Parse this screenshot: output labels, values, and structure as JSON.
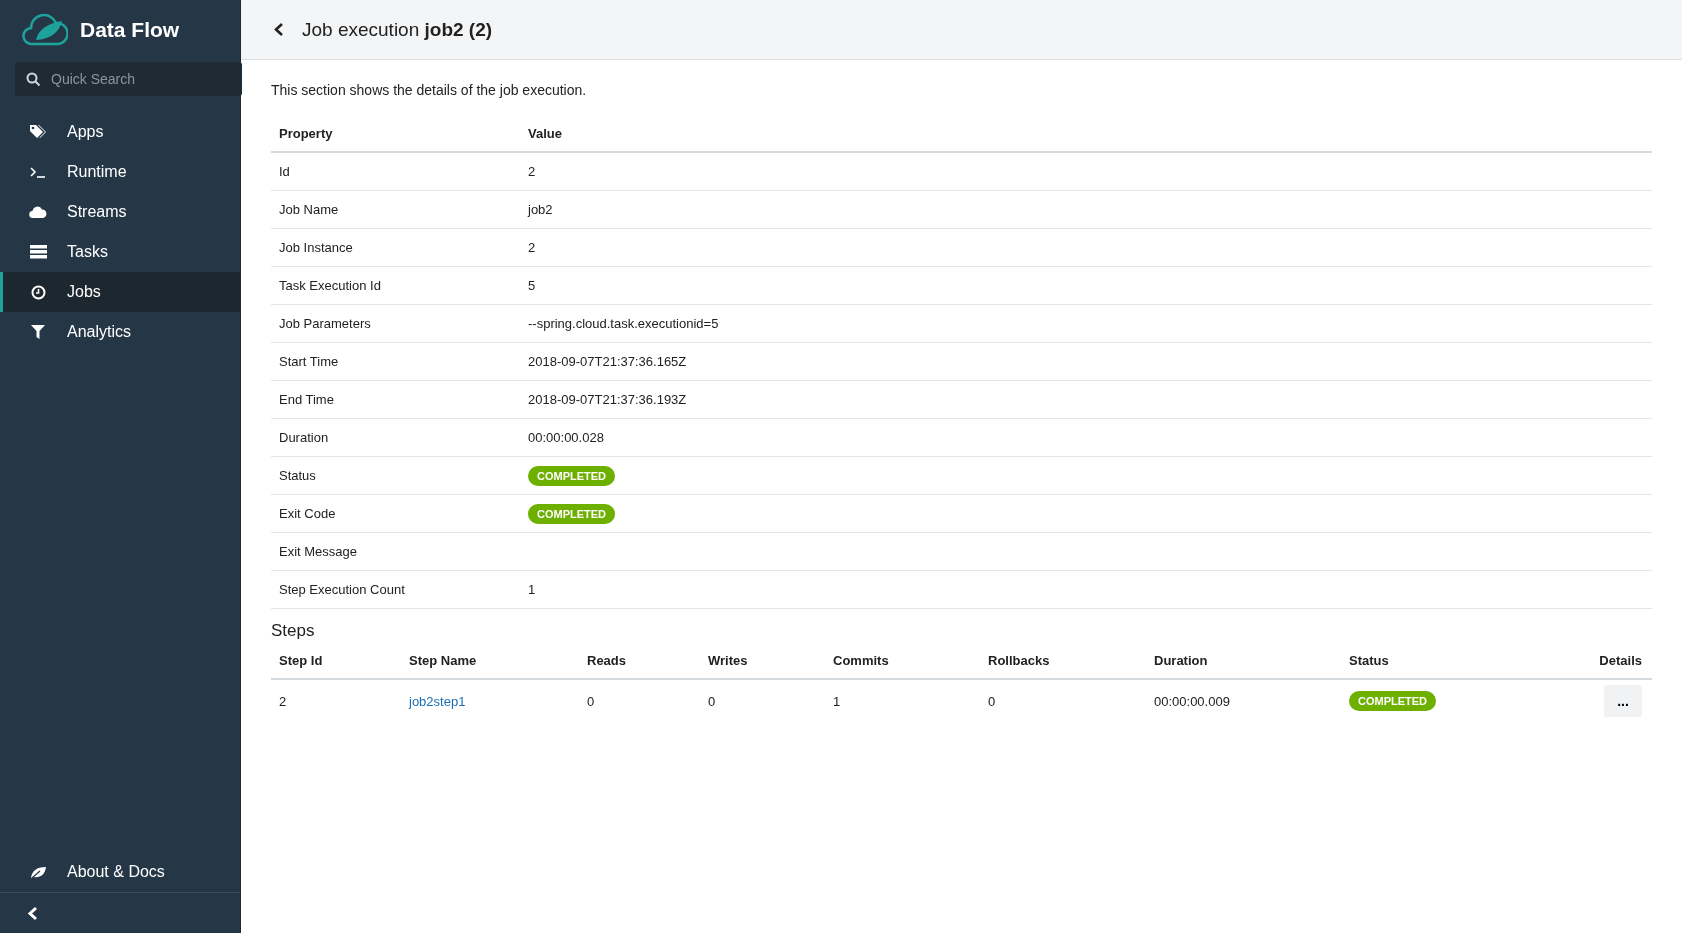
{
  "sidebar": {
    "brand": "Data Flow",
    "search": {
      "placeholder": "Quick Search"
    },
    "items": [
      {
        "label": "Apps",
        "selected": false
      },
      {
        "label": "Runtime",
        "selected": false
      },
      {
        "label": "Streams",
        "selected": false
      },
      {
        "label": "Tasks",
        "selected": false
      },
      {
        "label": "Jobs",
        "selected": true
      },
      {
        "label": "Analytics",
        "selected": false
      }
    ],
    "footer_item": {
      "label": "About & Docs"
    }
  },
  "header": {
    "title": "Job execution **job2 (2)**"
  },
  "description": "This section shows the details of the job execution.",
  "details": {
    "columns": [
      "Property",
      "Value"
    ],
    "rows": [
      {
        "property": "Id",
        "value": "2",
        "kind": "text"
      },
      {
        "property": "Job Name",
        "value": "job2",
        "kind": "text"
      },
      {
        "property": "Job Instance",
        "value": "2",
        "kind": "text"
      },
      {
        "property": "Task Execution Id",
        "value": "5",
        "kind": "text"
      },
      {
        "property": "Job Parameters",
        "value": "--spring.cloud.task.executionid=5",
        "kind": "text"
      },
      {
        "property": "Start Time",
        "value": "2018-09-07T21:37:36.165Z",
        "kind": "text"
      },
      {
        "property": "End Time",
        "value": "2018-09-07T21:37:36.193Z",
        "kind": "text"
      },
      {
        "property": "Duration",
        "value": "00:00:00.028",
        "kind": "text"
      },
      {
        "property": "Status",
        "value": "COMPLETED",
        "kind": "badge"
      },
      {
        "property": "Exit Code",
        "value": "COMPLETED",
        "kind": "badge"
      },
      {
        "property": "Exit Message",
        "value": "",
        "kind": "text"
      },
      {
        "property": "Step Execution Count",
        "value": "1",
        "kind": "text"
      }
    ]
  },
  "steps": {
    "title": "Steps",
    "columns": [
      "Step Id",
      "Step Name",
      "Reads",
      "Writes",
      "Commits",
      "Rollbacks",
      "Duration",
      "Status",
      "Details"
    ],
    "rows": [
      {
        "step_id": "2",
        "step_name": "job2step1",
        "reads": "0",
        "writes": "0",
        "commits": "1",
        "rollbacks": "0",
        "duration": "00:00:00.009",
        "status": "COMPLETED",
        "details": "..."
      }
    ]
  }
}
